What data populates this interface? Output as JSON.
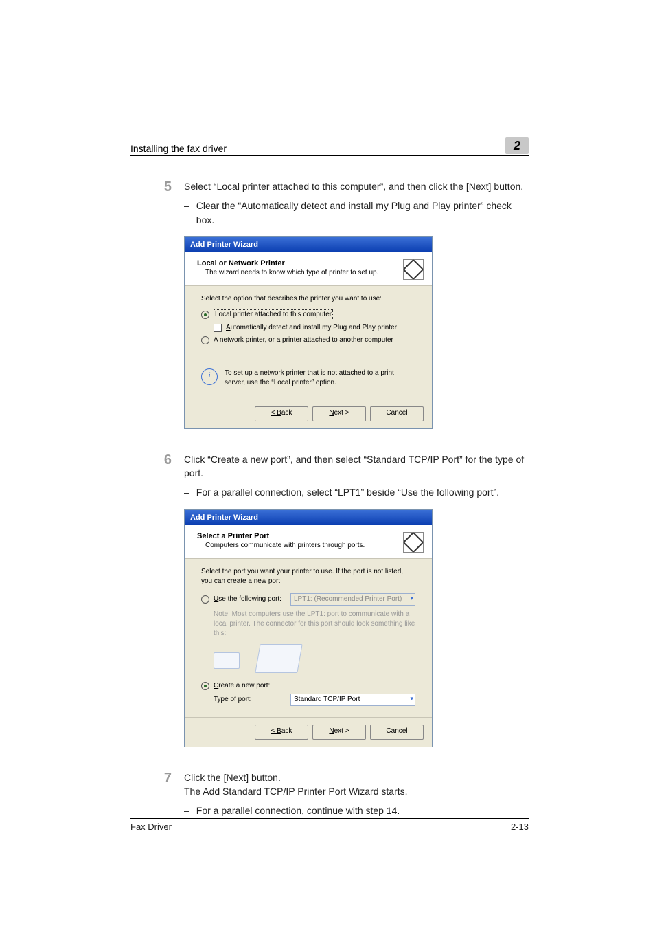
{
  "header": {
    "title": "Installing the fax driver",
    "chapter": "2"
  },
  "steps": [
    {
      "num": "5",
      "text": "Select “Local printer attached to this computer”, and then click the [Next] button.",
      "subs": [
        "Clear the “Automatically detect and install my Plug and Play printer” check box."
      ]
    },
    {
      "num": "6",
      "text": "Click “Create a new port”, and then select “Standard TCP/IP Port” for the type of port.",
      "subs": [
        "For a parallel connection, select “LPT1” beside “Use the following port”."
      ]
    },
    {
      "num": "7",
      "text": "Click the [Next] button.",
      "tail": "The Add Standard TCP/IP Printer Port Wizard starts.",
      "subs": [
        "For a parallel connection, continue with step 14."
      ]
    }
  ],
  "dialog1": {
    "title": "Add Printer Wizard",
    "head_title": "Local or Network Printer",
    "head_sub": "The wizard needs to know which type of printer to set up.",
    "prompt": "Select the option that describes the printer you want to use:",
    "opt_local": "Local printer attached to this computer",
    "opt_auto": "Automatically detect and install my Plug and Play printer",
    "opt_net": "A network printer, or a printer attached to another computer",
    "info": "To set up a network printer that is not attached to a print server, use the “Local printer” option.",
    "back": "< Back",
    "next": "Next >",
    "cancel": "Cancel"
  },
  "dialog2": {
    "title": "Add Printer Wizard",
    "head_title": "Select a Printer Port",
    "head_sub": "Computers communicate with printers through ports.",
    "prompt": "Select the port you want your printer to use.  If the port is not listed, you can create a new port.",
    "use_following": "Use the following port:",
    "lpt": "LPT1: (Recommended Printer Port)",
    "note": "Note: Most computers use the LPT1: port to communicate with a local printer. The connector for this port should look something like this:",
    "create_new": "Create a new port:",
    "type_label": "Type of port:",
    "type_value": "Standard TCP/IP Port",
    "back": "< Back",
    "next": "Next >",
    "cancel": "Cancel"
  },
  "footer": {
    "left": "Fax Driver",
    "right": "2-13"
  }
}
